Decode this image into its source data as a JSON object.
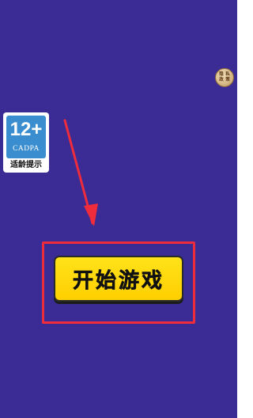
{
  "privacy": {
    "label_chars": [
      "隐",
      "私",
      "政",
      "策"
    ]
  },
  "age_rating": {
    "age": "12+",
    "org": "CADPA",
    "caption": "适龄提示"
  },
  "start_button": {
    "label": "开始游戏"
  },
  "colors": {
    "background": "#3a2b95",
    "button": "#ffd20a",
    "highlight": "#ee2c3c",
    "badge_blue": "#3a8ed0"
  },
  "icons": {
    "privacy": "privacy-policy-icon",
    "arrow": "arrow-down-icon"
  }
}
